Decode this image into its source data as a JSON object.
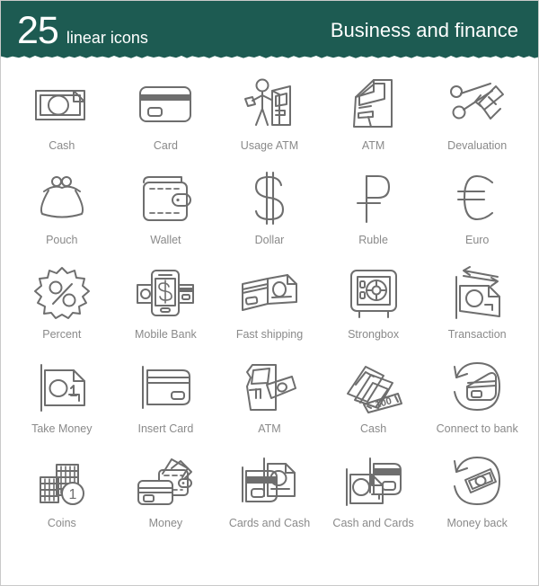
{
  "header": {
    "count": "25",
    "count_subtitle": "linear icons",
    "title": "Business and finance",
    "background_color": "#1d5b52",
    "text_color": "#ffffff"
  },
  "style": {
    "page_background": "#ffffff",
    "icon_stroke_color": "#6e6e6e",
    "label_color": "#8a8a8a",
    "border_color": "#c9c9c9"
  },
  "grid": {
    "columns": 5,
    "rows": 5,
    "total_icons": 25
  },
  "icons": [
    {
      "label": "Cash",
      "icon_name": "banknote-icon"
    },
    {
      "label": "Card",
      "icon_name": "credit-card-icon"
    },
    {
      "label": "Usage ATM",
      "icon_name": "person-at-atm-icon"
    },
    {
      "label": "ATM",
      "icon_name": "atm-machine-icon"
    },
    {
      "label": "Devaluation",
      "icon_name": "scissors-cutting-banknote-icon"
    },
    {
      "label": "Pouch",
      "icon_name": "coin-purse-icon"
    },
    {
      "label": "Wallet",
      "icon_name": "wallet-icon"
    },
    {
      "label": "Dollar",
      "icon_name": "dollar-sign-icon"
    },
    {
      "label": "Ruble",
      "icon_name": "ruble-sign-icon"
    },
    {
      "label": "Euro",
      "icon_name": "euro-sign-icon"
    },
    {
      "label": "Percent",
      "icon_name": "percent-badge-icon"
    },
    {
      "label": "Mobile Bank",
      "icon_name": "mobile-banking-icon"
    },
    {
      "label": "Fast shipping",
      "icon_name": "card-and-banknote-folded-icon"
    },
    {
      "label": "Strongbox",
      "icon_name": "safe-box-icon"
    },
    {
      "label": "Transaction",
      "icon_name": "banknote-exchange-arrows-icon"
    },
    {
      "label": "Take Money",
      "icon_name": "take-money-banknote-icon"
    },
    {
      "label": "Insert Card",
      "icon_name": "insert-card-icon"
    },
    {
      "label": "ATM",
      "icon_name": "atm-slot-with-cash-icon"
    },
    {
      "label": "Cash",
      "icon_name": "banknote-stack-100-icon"
    },
    {
      "label": "Connect  to bank",
      "icon_name": "card-refresh-circle-icon"
    },
    {
      "label": "Coins",
      "icon_name": "coin-stacks-icon"
    },
    {
      "label": "Money",
      "icon_name": "wallet-and-card-icon"
    },
    {
      "label": "Cards and Cash",
      "icon_name": "card-front-cash-back-icon"
    },
    {
      "label": "Cash and Cards",
      "icon_name": "cash-front-card-back-icon"
    },
    {
      "label": "Money back",
      "icon_name": "banknote-refresh-circle-icon"
    }
  ],
  "icon_details": {
    "coins_value": "1",
    "banknote_value": "100"
  }
}
